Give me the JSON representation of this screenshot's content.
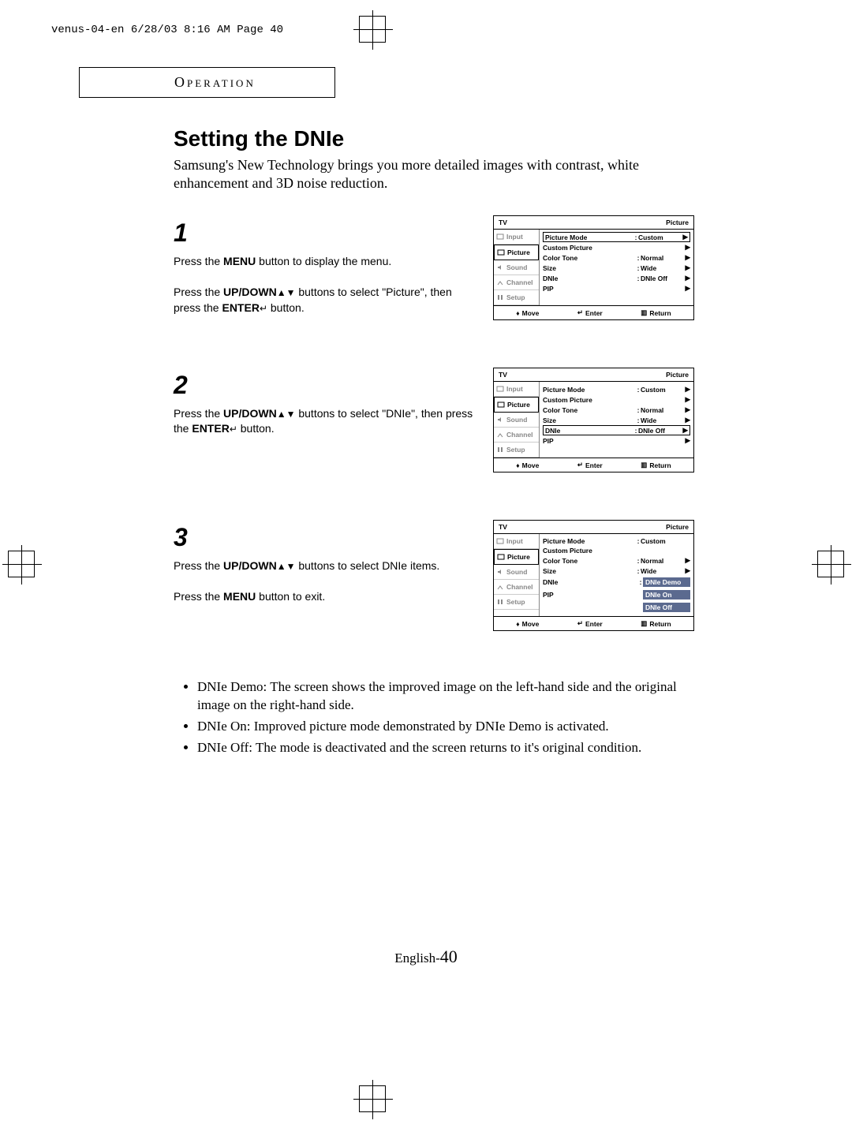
{
  "print_header": "venus-04-en  6/28/03 8:16 AM  Page 40",
  "section_label": "Operation",
  "title": "Setting the DNIe",
  "intro": "Samsung's New Technology brings you more detailed images with contrast, white enhancement and 3D noise reduction.",
  "steps": {
    "s1": {
      "num": "1",
      "p1a": "Press the ",
      "p1b": "MENU",
      "p1c": " button to display the menu.",
      "p2a": "Press the ",
      "p2b": "UP/DOWN",
      "p2c": " buttons to select \"Picture\", then press the ",
      "p2d": "ENTER",
      "p2e": " button."
    },
    "s2": {
      "num": "2",
      "p1a": "Press the ",
      "p1b": "UP/DOWN",
      "p1c": " buttons to select \"DNIe\", then press the ",
      "p1d": "ENTER",
      "p1e": " button."
    },
    "s3": {
      "num": "3",
      "p1a": "Press the ",
      "p1b": "UP/DOWN",
      "p1c": " buttons to select DNIe items.",
      "p2a": "Press the ",
      "p2b": "MENU",
      "p2c": " button to exit."
    }
  },
  "osd_common": {
    "tv": "TV",
    "heading": "Picture",
    "tabs": {
      "input": "Input",
      "picture": "Picture",
      "sound": "Sound",
      "channel": "Channel",
      "setup": "Setup"
    },
    "rows": {
      "picture_mode": "Picture Mode",
      "custom_picture": "Custom Picture",
      "color_tone": "Color Tone",
      "size": "Size",
      "dnie": "DNIe",
      "pip": "PIP"
    },
    "vals": {
      "custom": "Custom",
      "normal": "Normal",
      "wide": "Wide",
      "dnie_off": "DNIe Off",
      "dnie_demo": "DNIe Demo",
      "dnie_on": "DNIe On"
    },
    "footer": {
      "move": "Move",
      "enter": "Enter",
      "return": "Return"
    }
  },
  "notes": {
    "n1": "DNIe Demo: The screen shows the improved image on the left-hand side and the original image on the right-hand side.",
    "n2": "DNIe On: Improved picture mode demonstrated by DNIe Demo is activated.",
    "n3": "DNIe Off: The mode is deactivated and the screen returns to it's original condition."
  },
  "footer_page": {
    "lang": "English-",
    "num": "40"
  }
}
